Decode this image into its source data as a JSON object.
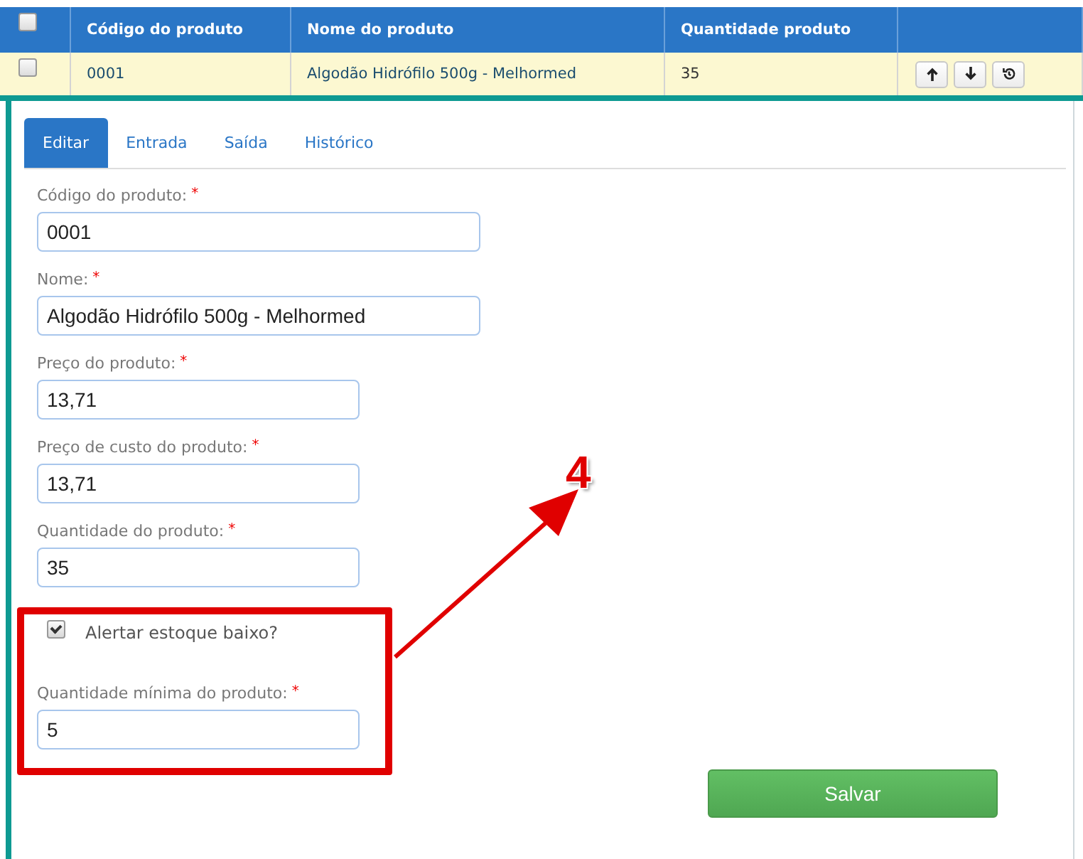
{
  "table": {
    "select_all": {
      "checked": false
    },
    "columns": [
      "Código do produto",
      "Nome do produto",
      "Quantidade produto"
    ],
    "rows": [
      {
        "selected": false,
        "cells": [
          "0001",
          "Algodão Hidrófilo 500g - Melhormed",
          "35"
        ],
        "actions": [
          {
            "kind": "move-up"
          },
          {
            "kind": "move-down"
          },
          {
            "kind": "history"
          }
        ]
      }
    ]
  },
  "tabs": [
    {
      "label": "Editar",
      "selected": true
    },
    {
      "label": "Entrada",
      "selected": false
    },
    {
      "label": "Saída",
      "selected": false
    },
    {
      "label": "Histórico",
      "selected": false
    }
  ],
  "fields": [
    {
      "kind": "text",
      "label": "Código do produto:",
      "required_mark": "*",
      "value": "0001",
      "wide": true
    },
    {
      "kind": "text",
      "label": "Nome:",
      "required_mark": "*",
      "value": "Algodão Hidrófilo 500g - Melhormed",
      "wide": true
    },
    {
      "kind": "text",
      "label": "Preço do produto:",
      "required_mark": "*",
      "value": "13,71",
      "wide": false
    },
    {
      "kind": "text",
      "label": "Preço de custo do produto:",
      "required_mark": "*",
      "value": "13,71",
      "wide": false
    },
    {
      "kind": "text",
      "label": "Quantidade do produto:",
      "required_mark": "*",
      "value": "35",
      "wide": false
    },
    {
      "kind": "checkbox",
      "label": "Alertar estoque baixo?",
      "checked": true
    },
    {
      "kind": "text",
      "label": "Quantidade mínima do produto:",
      "required_mark": "*",
      "value": "5",
      "wide": false
    }
  ],
  "save_button": "Salvar",
  "annotation": {
    "label": "4"
  }
}
